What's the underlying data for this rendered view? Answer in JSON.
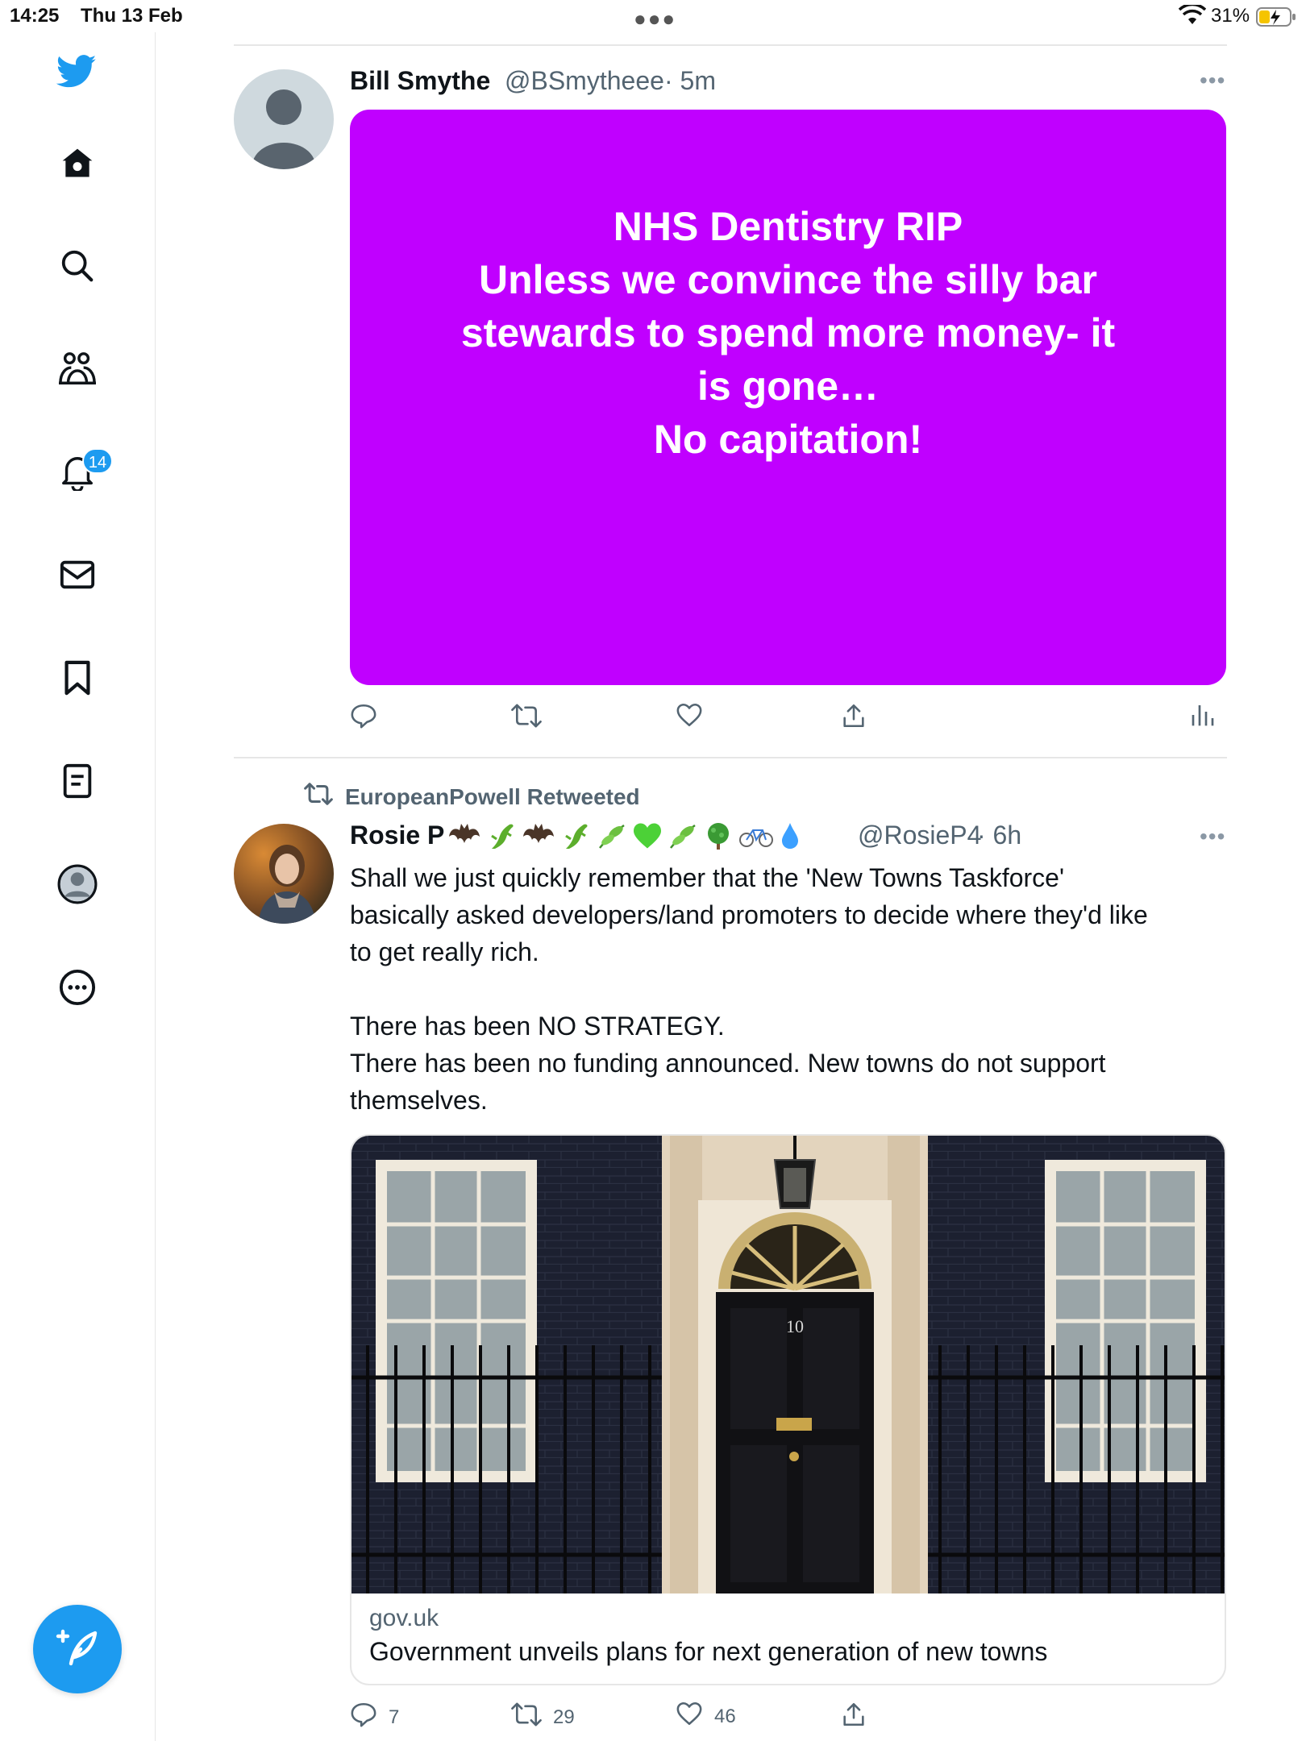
{
  "status_bar": {
    "time": "14:25",
    "date": "Thu 13 Feb",
    "battery": "31%"
  },
  "sidebar": {
    "items": [
      {
        "name": "home",
        "icon": "home-icon"
      },
      {
        "name": "explore",
        "icon": "search-icon"
      },
      {
        "name": "communities",
        "icon": "people-icon"
      },
      {
        "name": "notifications",
        "icon": "bell-icon",
        "badge": "14"
      },
      {
        "name": "messages",
        "icon": "mail-icon"
      },
      {
        "name": "bookmarks",
        "icon": "bookmark-icon"
      },
      {
        "name": "lists",
        "icon": "list-icon"
      },
      {
        "name": "profile",
        "icon": "profile-icon"
      },
      {
        "name": "more",
        "icon": "more-circle-icon"
      }
    ],
    "notification_badge": "14",
    "accent": "#1d9bf0"
  },
  "tweets": [
    {
      "name": "Bill Smythe",
      "handle": "@BSmytheee",
      "time": "· 5m",
      "card_color": "#c000ff",
      "card_lines": [
        "NHS Dentistry RIP",
        "Unless we convince the silly bar",
        "stewards to spend more money- it",
        "is gone…",
        "No capitation!"
      ]
    },
    {
      "retweeted_by": "EuropeanPowell Retweeted",
      "name": "Rosie P",
      "handle": "@RosieP4",
      "time": "· 6h",
      "text_lines": [
        "Shall we just quickly remember that the 'New Towns Taskforce'",
        "basically asked developers/land promoters to decide where they'd like",
        "to get really rich.",
        "There has been NO STRATEGY.",
        "There has been no funding announced.  New towns do not support",
        "themselves."
      ],
      "link_domain": "gov.uk",
      "link_title": "Government unveils plans for next generation of new towns",
      "door_number": "10",
      "replies": "7",
      "retweets": "29",
      "likes": "46"
    }
  ]
}
